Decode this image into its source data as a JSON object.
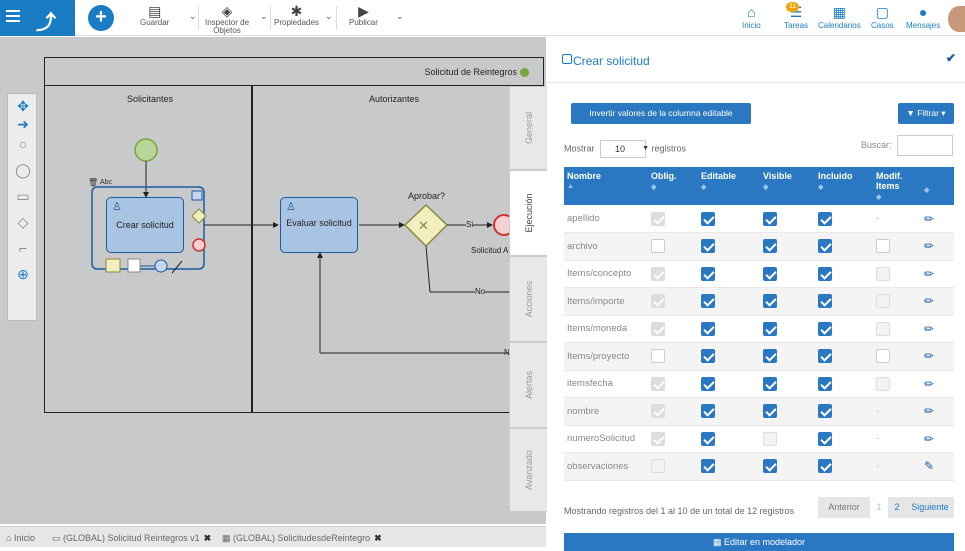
{
  "toolbar": {
    "guardar": "Guardar",
    "inspector": "Inspector de Objetos",
    "propiedades": "Propiedades",
    "publicar": "Publicar"
  },
  "nav": {
    "inicio": "Inicio",
    "tareas": "Tareas",
    "tareas_badge": "11",
    "calendarios": "Calendarios",
    "casos": "Casos",
    "mensajes": "Mensajes"
  },
  "diagram": {
    "pool_name": "Solicitud de Reintegros",
    "lane1": "Solicitantes",
    "lane2": "Autorizantes",
    "task1": "Crear solicitud",
    "task2": "Evaluar solicitud",
    "gateway": "Aprobar?",
    "flow_si": "Si",
    "flow_no": "No",
    "flow_n": "N",
    "end_label": "Solicitud A",
    "annot": "Abc"
  },
  "sidetabs": [
    "General",
    "Ejecución",
    "Acciones",
    "Alertas",
    "Avanzado"
  ],
  "bottombar": {
    "inicio": "Inicio",
    "tab1": "(GLOBAL) Solicitud Reintegros v1",
    "tab2": "(GLOBAL) SolicitudesdeReintegro"
  },
  "panel": {
    "title": "Crear solicitud",
    "invert_btn": "Invertir valores de la columna editable",
    "filter_btn": "Filtrar",
    "mostrar": "Mostrar",
    "page_size": "10",
    "registros": "registros",
    "buscar": "Buscar:",
    "columns": [
      "Nombre",
      "Oblig.",
      "Editable",
      "Visible",
      "Incluido",
      "Modif. Items"
    ],
    "rows": [
      {
        "name": "apellido",
        "oblig": "dis",
        "editable": "on",
        "visible": "on",
        "incluido": "on",
        "modif": "-",
        "icon": "pencil"
      },
      {
        "name": "archivo",
        "oblig": "off",
        "editable": "on",
        "visible": "on",
        "incluido": "on",
        "modif": "off",
        "icon": "pencil"
      },
      {
        "name": "Items/concepto",
        "oblig": "dis",
        "editable": "on",
        "visible": "on",
        "incluido": "on",
        "modif": "empty",
        "icon": "pencil"
      },
      {
        "name": "Items/importe",
        "oblig": "dis",
        "editable": "on",
        "visible": "on",
        "incluido": "on",
        "modif": "empty",
        "icon": "pencil"
      },
      {
        "name": "Items/moneda",
        "oblig": "dis",
        "editable": "on",
        "visible": "on",
        "incluido": "on",
        "modif": "empty",
        "icon": "pencil"
      },
      {
        "name": "Items/proyecto",
        "oblig": "off",
        "editable": "on",
        "visible": "on",
        "incluido": "on",
        "modif": "off",
        "icon": "pencil"
      },
      {
        "name": "itemsfecha",
        "oblig": "dis",
        "editable": "on",
        "visible": "on",
        "incluido": "on",
        "modif": "empty",
        "icon": "pencil"
      },
      {
        "name": "nombre",
        "oblig": "dis",
        "editable": "on",
        "visible": "on",
        "incluido": "on",
        "modif": "-",
        "icon": "pencil"
      },
      {
        "name": "numeroSolicitud",
        "oblig": "dis",
        "editable": "on",
        "visible": "empty",
        "incluido": "on",
        "modif": "-",
        "icon": "pencil"
      },
      {
        "name": "observaciones",
        "oblig": "empty",
        "editable": "on",
        "visible": "on",
        "incluido": "on",
        "modif": "-",
        "icon": "pencil-box"
      }
    ],
    "footer_info": "Mostrando registros del 1 al 10 de un total de 12 registros",
    "pager": {
      "prev": "Anterior",
      "p1": "1",
      "p2": "2",
      "next": "Siguiente"
    },
    "edit_btn": "Editar en modelador"
  }
}
